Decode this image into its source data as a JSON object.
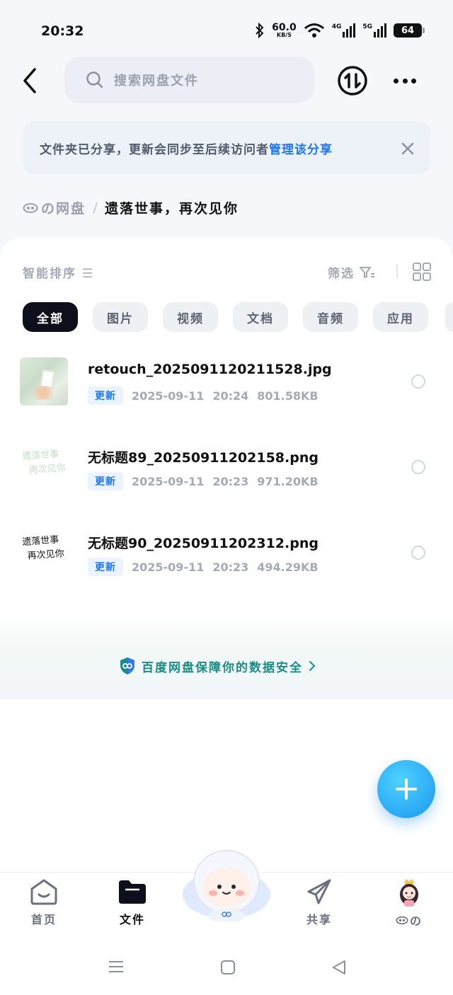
{
  "status_bar": {
    "time": "20:32",
    "net_speed": "60.0",
    "net_speed_unit": "KB/S",
    "sim1": "4G",
    "sim2": "5G",
    "battery": "64"
  },
  "header": {
    "search_placeholder": "搜索网盘文件"
  },
  "banner": {
    "text": "文件夹已分享，更新会同步至后续访问者",
    "link": "管理该分享"
  },
  "breadcrumb": {
    "root": "の网盘",
    "separator": "/",
    "current": "遗落世事，再次见你"
  },
  "toolbar": {
    "sort_label": "智能排序",
    "filter_label": "筛选"
  },
  "chips": [
    "全部",
    "图片",
    "视频",
    "文档",
    "音频",
    "应用"
  ],
  "files": [
    {
      "name": "retouch_2025091120211528.jpg",
      "badge": "更新",
      "date": "2025-09-11",
      "time": "20:24",
      "size": "801.58KB"
    },
    {
      "name": "无标题89_20250911202158.png",
      "badge": "更新",
      "date": "2025-09-11",
      "time": "20:23",
      "size": "971.20KB"
    },
    {
      "name": "无标题90_20250911202312.png",
      "badge": "更新",
      "date": "2025-09-11",
      "time": "20:23",
      "size": "494.29KB"
    }
  ],
  "thumb_text": {
    "line1": "遗落世事",
    "line2": "再次见你"
  },
  "safety_text": "百度网盘保障你的数据安全",
  "bottom_nav": {
    "home": "首页",
    "files": "文件",
    "share": "共享",
    "me": "の"
  },
  "colors": {
    "accent": "#1e77f2",
    "safe": "#1b8c86",
    "chip_active": "#0d0f1c"
  }
}
